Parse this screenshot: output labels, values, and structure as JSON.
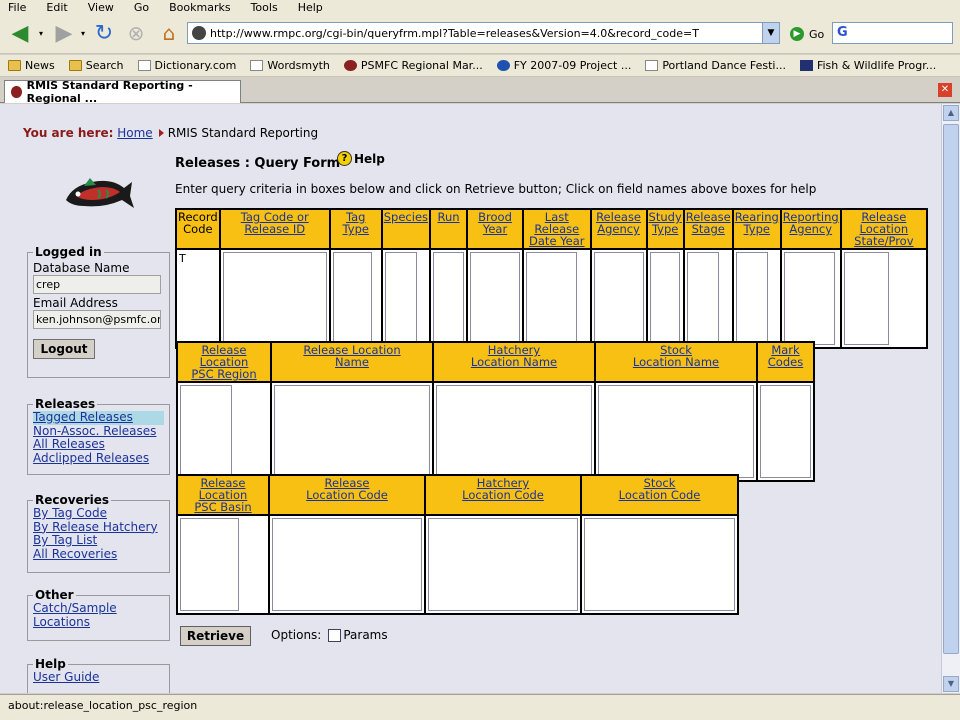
{
  "menu": [
    "File",
    "Edit",
    "View",
    "Go",
    "Bookmarks",
    "Tools",
    "Help"
  ],
  "address": {
    "url": "http://www.rmpc.org/cgi-bin/queryfrm.mpl?Table=releases&Version=4.0&record_code=T",
    "go_label": "Go",
    "search_value": "G"
  },
  "bookmarks": [
    "News",
    "Search",
    "Dictionary.com",
    "Wordsmyth",
    "PSMFC Regional Mar...",
    "FY 2007-09 Project ...",
    "Portland Dance Festi...",
    "Fish & Wildlife Progr..."
  ],
  "tab": {
    "title": "RMIS Standard Reporting - Regional ..."
  },
  "breadcrumb": {
    "label": "You are here:",
    "home": "Home",
    "current": "RMIS Standard Reporting"
  },
  "logged_in": {
    "legend": "Logged in",
    "db_label": "Database Name",
    "db_value": "crep",
    "email_label": "Email Address",
    "email_value": "ken.johnson@psmfc.org",
    "logout": "Logout"
  },
  "releases_nav": {
    "legend": "Releases",
    "items": [
      "Tagged Releases",
      "Non-Assoc. Releases",
      "All Releases",
      "Adclipped Releases"
    ]
  },
  "recoveries_nav": {
    "legend": "Recoveries",
    "items": [
      "By Tag Code",
      "By Release Hatchery",
      "By Tag List",
      "All Recoveries"
    ]
  },
  "other_nav": {
    "legend": "Other",
    "items": [
      "Catch/Sample",
      "Locations"
    ]
  },
  "help_nav": {
    "legend": "Help",
    "items": [
      "User Guide"
    ]
  },
  "form": {
    "title": "Releases : Query Form",
    "help": "Help",
    "instructions": "Enter query criteria in boxes below and click on Retrieve button; Click on field names above boxes for help",
    "record_code_label": [
      "Record",
      "Code"
    ],
    "record_code_value": "T",
    "row1": [
      [
        "Tag Code or",
        "Release ID"
      ],
      [
        "Tag Type"
      ],
      [
        "Species"
      ],
      [
        "Run"
      ],
      [
        "Brood",
        "Year"
      ],
      [
        "Last Release",
        "Date Year"
      ],
      [
        "Release",
        "Agency"
      ],
      [
        "Study",
        "Type"
      ],
      [
        "Release",
        "Stage"
      ],
      [
        "Rearing",
        "Type"
      ],
      [
        "Reporting",
        "Agency"
      ],
      [
        "Release Location",
        "State/Prov"
      ]
    ],
    "row2": [
      [
        "Release Location",
        "PSC Region"
      ],
      [
        "Release Location",
        "Name"
      ],
      [
        "Hatchery",
        "Location Name"
      ],
      [
        "Stock",
        "Location Name"
      ],
      [
        "Mark",
        "Codes"
      ]
    ],
    "row3": [
      [
        "Release Location",
        "PSC Basin"
      ],
      [
        "Release",
        "Location Code"
      ],
      [
        "Hatchery",
        "Location Code"
      ],
      [
        "Stock",
        "Location Code"
      ]
    ],
    "retrieve": "Retrieve",
    "options_label": "Options:",
    "params_label": "Params"
  },
  "status": "about:release_location_psc_region"
}
